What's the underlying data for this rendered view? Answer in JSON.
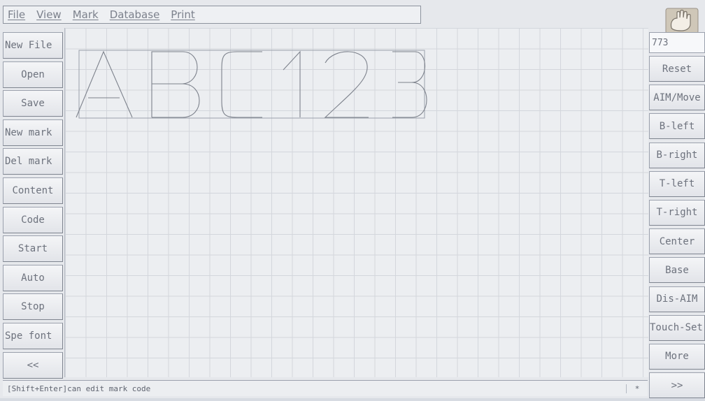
{
  "menu": {
    "file": "File",
    "view": "View",
    "mark": "Mark",
    "database": "Database",
    "print": "Print"
  },
  "left_buttons": [
    "New File",
    "Open",
    "Save",
    "New mark",
    "Del mark",
    "Content",
    "Code",
    "Start",
    "Auto",
    "Stop",
    "Spe font",
    "<<"
  ],
  "right": {
    "hand_icon": "hand-pointer-icon",
    "count": "773",
    "buttons": [
      "Reset",
      "AIM/Move",
      "B-left",
      "B-right",
      "T-left",
      "T-right",
      "Center",
      "Base",
      "Dis-AIM",
      "Touch-Set",
      "More",
      ">>"
    ]
  },
  "canvas": {
    "mark_text": "ABC123"
  },
  "status": {
    "message": "[Shift+Enter]can edit mark code",
    "indicator": "*"
  }
}
